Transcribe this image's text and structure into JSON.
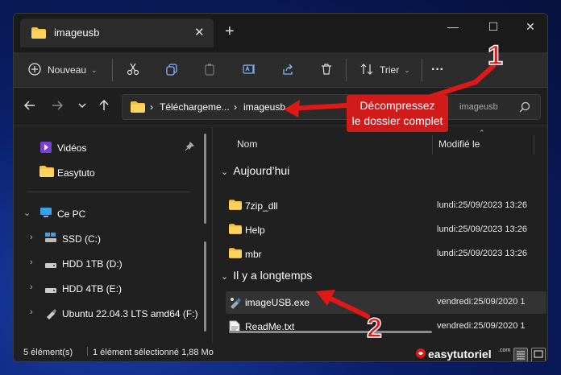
{
  "window": {
    "tab_title": "imageusb",
    "tab_close": "✕",
    "new_tab": "+",
    "minimize": "—",
    "maximize": "☐",
    "close": "✕"
  },
  "toolbar": {
    "new_label": "Nouveau",
    "sort_label": "Trier",
    "more": "···",
    "icons": [
      "plus-circle-icon",
      "cut-icon",
      "copy-icon",
      "paste-icon",
      "rename-icon",
      "share-icon",
      "delete-icon",
      "sort-icon"
    ]
  },
  "address": {
    "crumb_1": "Téléchargeme...",
    "crumb_2": "imageusb",
    "separator": "›",
    "search_placeholder": "imageusb"
  },
  "sidebar": {
    "items": [
      {
        "label": "Vidéos",
        "icon": "videos-icon"
      },
      {
        "label": "Easytuto",
        "icon": "folder-icon"
      },
      {
        "label": "Ce PC",
        "icon": "pc-icon"
      },
      {
        "label": "SSD (C:)",
        "icon": "drive-icon"
      },
      {
        "label": "HDD 1TB (D:)",
        "icon": "drive-icon"
      },
      {
        "label": "HDD 4TB (E:)",
        "icon": "drive-icon"
      },
      {
        "label": "Ubuntu 22.04.3 LTS amd64 (F:)",
        "icon": "usb-drive-icon"
      }
    ]
  },
  "content": {
    "col_name": "Nom",
    "col_modified": "Modifié le",
    "group_today": "Aujourd’hui",
    "group_old": "Il y a longtemps",
    "rows": [
      {
        "name": "7zip_dll",
        "date": "lundi:25/09/2023 13:26"
      },
      {
        "name": "Help",
        "date": "lundi:25/09/2023 13:26"
      },
      {
        "name": "mbr",
        "date": "lundi:25/09/2023 13:26"
      },
      {
        "name": "imageUSB.exe",
        "date": "vendredi:25/09/2020 1"
      },
      {
        "name": "ReadMe.txt",
        "date": "vendredi:25/09/2020 1"
      }
    ]
  },
  "status": {
    "count": "5 élément(s)",
    "selected": "1 élément sélectionné  1,88 Mo",
    "brand": "easytutoriel",
    "brand_suffix": ".com"
  },
  "annotations": {
    "callout": [
      "Décompressez",
      "le dossier complet"
    ],
    "num_1": "1",
    "num_2": "2",
    "color": "#e01818"
  }
}
